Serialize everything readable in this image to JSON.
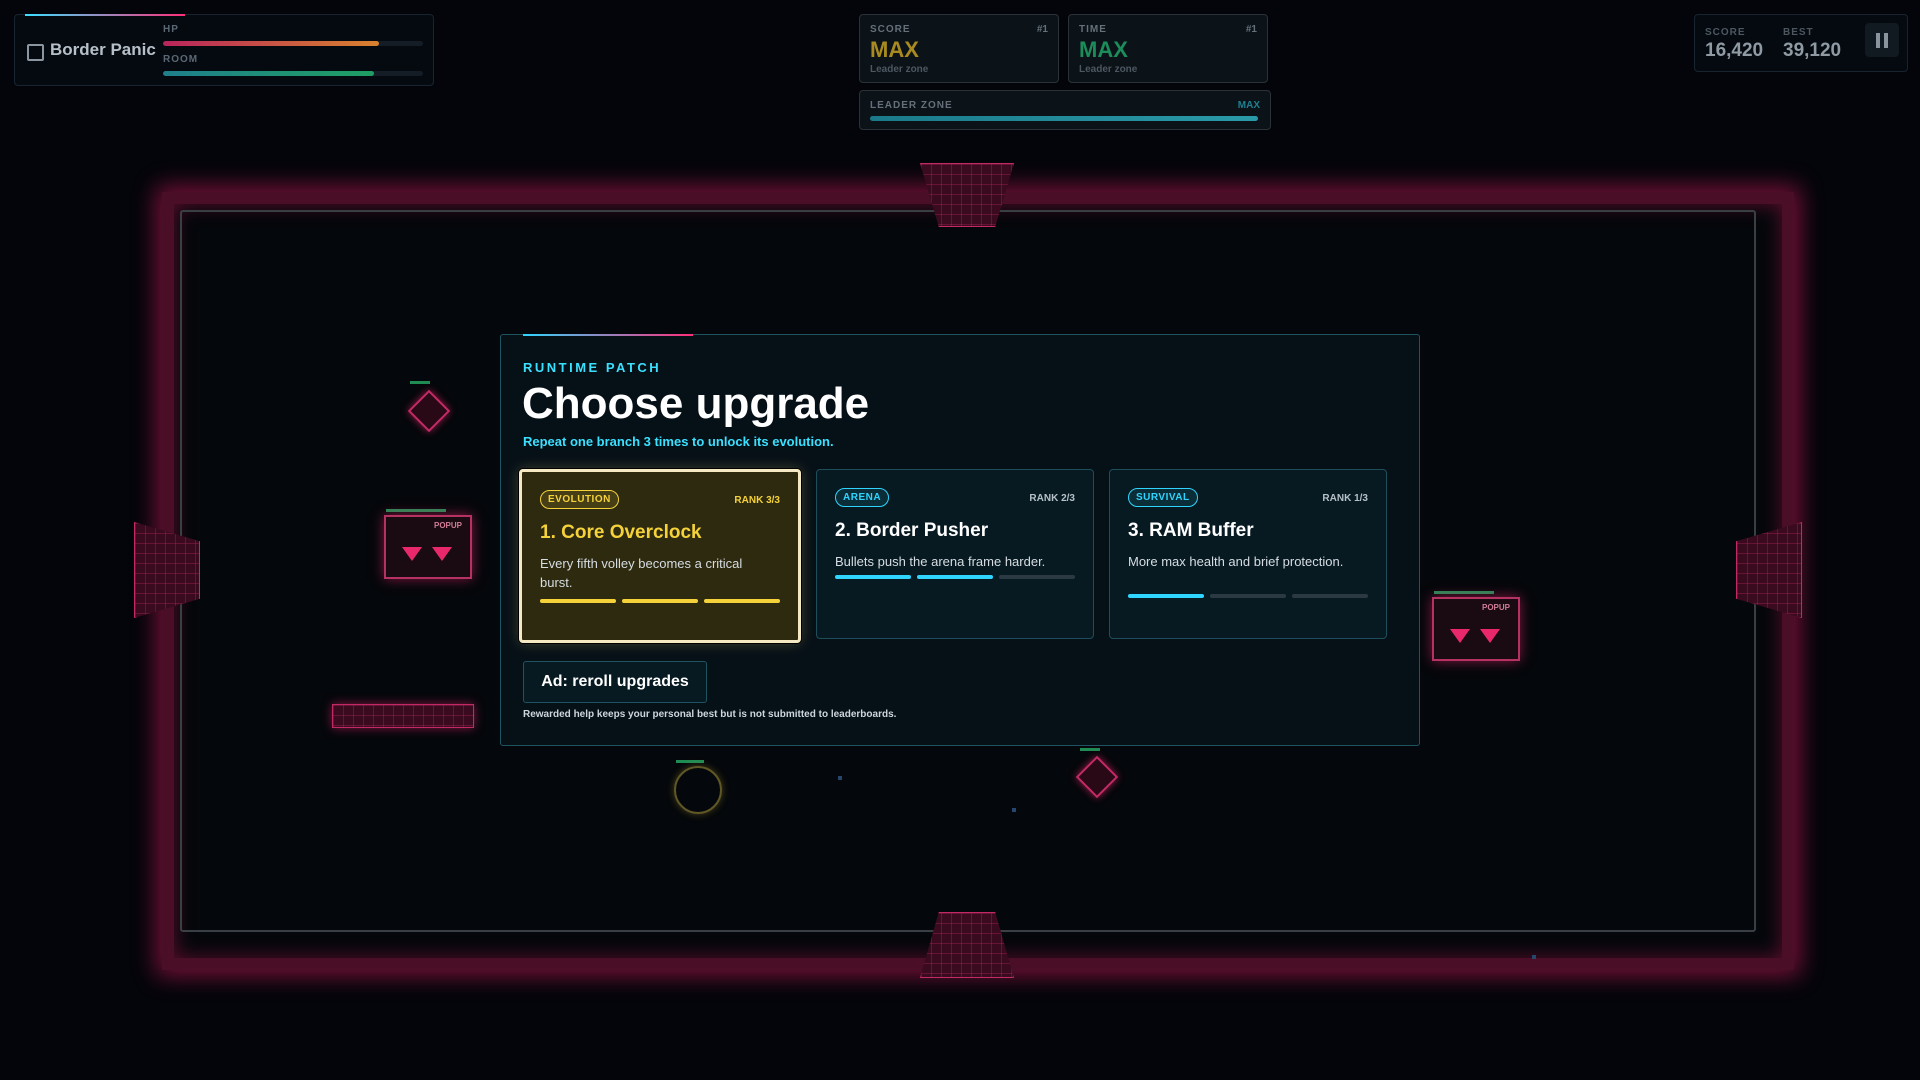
{
  "hud": {
    "game_name": "Border Panic",
    "hp_label": "HP",
    "hp_value": 0.83,
    "room_label": "ROOM",
    "room_value": 0.81,
    "score_card": {
      "label": "SCORE",
      "rank": "#1",
      "value": "MAX",
      "sub": "Leader zone",
      "color": "#a98a1e"
    },
    "time_card": {
      "label": "TIME",
      "rank": "#1",
      "value": "MAX",
      "sub": "Leader zone",
      "color": "#1b8c5a"
    },
    "leader_zone": {
      "label": "LEADER ZONE",
      "value_label": "MAX",
      "fill": 1.0
    },
    "score_label": "SCORE",
    "score_value": "16,420",
    "best_label": "BEST",
    "best_value": "39,120"
  },
  "arena": {
    "popup_label": "POPUP"
  },
  "modal": {
    "eyebrow": "RUNTIME PATCH",
    "title": "Choose upgrade",
    "subtitle": "Repeat one branch 3 times to unlock its evolution.",
    "cards": [
      {
        "tag": "EVOLUTION",
        "rank": "RANK 3/3",
        "name": "1. Core Overclock",
        "desc": "Every fifth volley becomes a critical burst.",
        "progress": 3,
        "max": 3,
        "accent": "#f5d23a",
        "selected": true
      },
      {
        "tag": "ARENA",
        "rank": "RANK 2/3",
        "name": "2. Border Pusher",
        "desc": "Bullets push the arena frame harder.",
        "progress": 2,
        "max": 3,
        "accent": "#2fd5ff",
        "selected": false
      },
      {
        "tag": "SURVIVAL",
        "rank": "RANK 1/3",
        "name": "3. RAM Buffer",
        "desc": "More max health and brief protection.",
        "progress": 1,
        "max": 3,
        "accent": "#2fd5ff",
        "selected": false
      }
    ],
    "reroll_label": "Ad: reroll upgrades",
    "reroll_note": "Rewarded help keeps your personal best but is not submitted to leaderboards."
  },
  "colors": {
    "accent_cyan": "#3be0ff",
    "accent_pink": "#ff2f7a",
    "accent_gold": "#f5d23a"
  }
}
